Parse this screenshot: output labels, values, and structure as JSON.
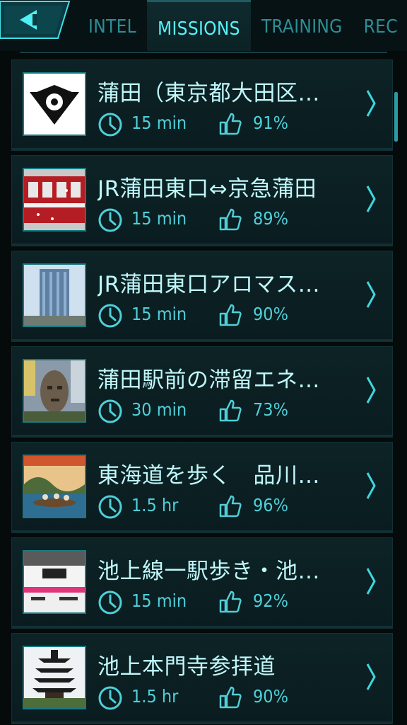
{
  "nav": {
    "tabs": [
      {
        "label": "INTEL"
      },
      {
        "label": "MISSIONS"
      },
      {
        "label": "TRAINING"
      },
      {
        "label": "REC"
      }
    ],
    "active_tab": "MISSIONS"
  },
  "missions": [
    {
      "title": "蒲田（東京都大田区…",
      "duration": "15 min",
      "rating": "91%"
    },
    {
      "title": "JR蒲田東口⇔京急蒲田",
      "duration": "15 min",
      "rating": "89%"
    },
    {
      "title": "JR蒲田東口アロマス…",
      "duration": "15 min",
      "rating": "90%"
    },
    {
      "title": "蒲田駅前の滞留エネ…",
      "duration": "30 min",
      "rating": "73%"
    },
    {
      "title": "東海道を歩く　品川…",
      "duration": "1.5 hr",
      "rating": "96%"
    },
    {
      "title": "池上線一駅歩き・池…",
      "duration": "15 min",
      "rating": "92%"
    },
    {
      "title": "池上本門寺参拝道",
      "duration": "1.5 hr",
      "rating": "90%"
    }
  ],
  "colors": {
    "accent": "#57f2f8",
    "text": "#bff7fa",
    "meta": "#4fcfd8",
    "background": "#050a0b"
  }
}
